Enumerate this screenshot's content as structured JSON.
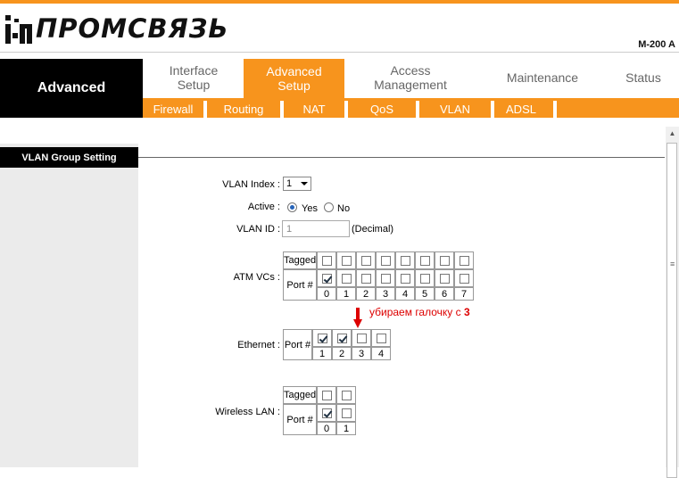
{
  "brand": {
    "logo_text": "ПРОМСВЯЗЬ",
    "model": "M-200 A"
  },
  "nav": {
    "section": "Advanced",
    "tabs": [
      {
        "label_line1": "Interface",
        "label_line2": "Setup",
        "active": false
      },
      {
        "label_line1": "Advanced",
        "label_line2": "Setup",
        "active": true
      },
      {
        "label_line1": "Access",
        "label_line2": "Management",
        "active": false
      },
      {
        "label_line1": "Maintenance",
        "label_line2": "",
        "active": false
      },
      {
        "label_line1": "Status",
        "label_line2": "",
        "active": false
      }
    ],
    "subtabs": [
      "Firewall",
      "Routing",
      "NAT",
      "QoS",
      "VLAN",
      "ADSL"
    ]
  },
  "section_title": "VLAN Group Setting",
  "form": {
    "vlan_index_label": "VLAN Index :",
    "vlan_index_value": "1",
    "active_label": "Active :",
    "active_yes": "Yes",
    "active_no": "No",
    "active_value": "Yes",
    "vlan_id_label": "VLAN ID :",
    "vlan_id_value": "1",
    "vlan_id_unit": "(Decimal)",
    "atm_label": "ATM VCs :",
    "ethernet_label": "Ethernet :",
    "wireless_label": "Wireless LAN :",
    "tagged_label": "Tagged",
    "port_label": "Port #"
  },
  "atm": {
    "ports": [
      "0",
      "1",
      "2",
      "3",
      "4",
      "5",
      "6",
      "7"
    ],
    "tagged": [
      false,
      false,
      false,
      false,
      false,
      false,
      false,
      false
    ],
    "port": [
      true,
      false,
      false,
      false,
      false,
      false,
      false,
      false
    ]
  },
  "ethernet": {
    "ports": [
      "1",
      "2",
      "3",
      "4"
    ],
    "port": [
      true,
      true,
      false,
      false
    ]
  },
  "wireless": {
    "ports": [
      "0",
      "1"
    ],
    "tagged": [
      false,
      false
    ],
    "port": [
      true,
      false
    ]
  },
  "annotation": {
    "text": "убираем галочку с ",
    "bold": "3"
  },
  "colors": {
    "accent": "#f7941d",
    "annotation": "#dd0000"
  }
}
